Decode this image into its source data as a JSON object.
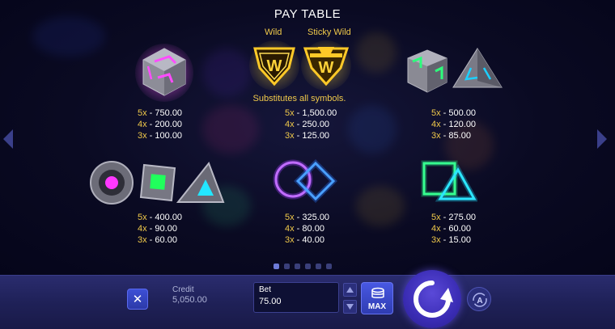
{
  "title": "PAY TABLE",
  "wild": {
    "label_wild": "Wild",
    "label_sticky": "Sticky Wild",
    "description": "Substitutes all symbols."
  },
  "paytable": [
    {
      "symbol": "purple-cube",
      "pays": [
        {
          "k": "5x",
          "v": "750.00"
        },
        {
          "k": "4x",
          "v": "200.00"
        },
        {
          "k": "3x",
          "v": "100.00"
        }
      ]
    },
    {
      "symbol": "wild",
      "pays": [
        {
          "k": "5x",
          "v": "1,500.00"
        },
        {
          "k": "4x",
          "v": "250.00"
        },
        {
          "k": "3x",
          "v": "125.00"
        }
      ]
    },
    {
      "symbol": "green-cube-pyramid",
      "pays": [
        {
          "k": "5x",
          "v": "500.00"
        },
        {
          "k": "4x",
          "v": "120.00"
        },
        {
          "k": "3x",
          "v": "85.00"
        }
      ]
    },
    {
      "symbol": "circle-square-triangle",
      "pays": [
        {
          "k": "5x",
          "v": "400.00"
        },
        {
          "k": "4x",
          "v": "90.00"
        },
        {
          "k": "3x",
          "v": "60.00"
        }
      ]
    },
    {
      "symbol": "neon-circle-diamond",
      "pays": [
        {
          "k": "5x",
          "v": "325.00"
        },
        {
          "k": "4x",
          "v": "80.00"
        },
        {
          "k": "3x",
          "v": "40.00"
        }
      ]
    },
    {
      "symbol": "neon-square-triangle",
      "pays": [
        {
          "k": "5x",
          "v": "275.00"
        },
        {
          "k": "4x",
          "v": "60.00"
        },
        {
          "k": "3x",
          "v": "15.00"
        }
      ]
    }
  ],
  "pagination": {
    "count": 6,
    "active": 0
  },
  "controls": {
    "credit_label": "Credit",
    "credit_value": "5,050.00",
    "bet_label": "Bet",
    "bet_value": "75.00",
    "max_label": "MAX"
  },
  "colors": {
    "gold": "#f0c94a",
    "purple_neon": "#a040ff",
    "blue_neon": "#2c7bff",
    "green_neon": "#28ff8a",
    "bar": "#1f2158",
    "spin": "#3a2cb4"
  }
}
